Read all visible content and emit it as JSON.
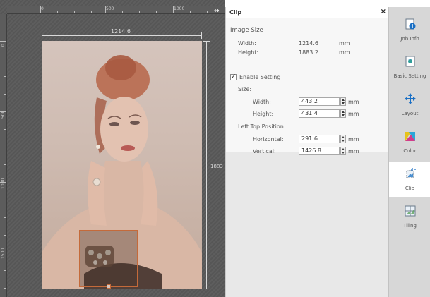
{
  "canvas": {
    "top_ruler_labels": [
      "0",
      "500",
      "1000"
    ],
    "left_ruler_labels": [
      "0",
      "500",
      "1000",
      "1500"
    ],
    "width_dimension": "1214.6",
    "height_dimension": "1883",
    "collapse_icon": "double-arrow-icon"
  },
  "panel": {
    "title": "Clip",
    "close_label": "×",
    "image_size_heading": "Image Size",
    "width_label": "Width:",
    "width_value": "1214.6",
    "width_unit": "mm",
    "height_label": "Height:",
    "height_value": "1883.2",
    "height_unit": "mm",
    "enable_setting_label": "Enable Setting",
    "enable_setting_checked": true,
    "size_heading": "Size:",
    "size_width_label": "Width:",
    "size_width_value": "443.2",
    "size_width_unit": "mm",
    "size_height_label": "Height:",
    "size_height_value": "431.4",
    "size_height_unit": "mm",
    "position_heading": "Left Top Position:",
    "horizontal_label": "Horizontal:",
    "horizontal_value": "291.6",
    "horizontal_unit": "mm",
    "vertical_label": "Vertical:",
    "vertical_value": "1426.8",
    "vertical_unit": "mm"
  },
  "sidebar": {
    "items": [
      {
        "label": "Job Info",
        "icon": "info-icon"
      },
      {
        "label": "Basic Setting",
        "icon": "basic-setting-icon"
      },
      {
        "label": "Layout",
        "icon": "layout-icon"
      },
      {
        "label": "Color",
        "icon": "color-icon"
      },
      {
        "label": "Clip",
        "icon": "clip-icon",
        "active": true
      },
      {
        "label": "Tiling",
        "icon": "tiling-icon"
      }
    ]
  },
  "colors": {
    "accent": "#1a6fc4",
    "clip_frame": "#c46a3a",
    "canvas_bg": "#5b5b5b"
  }
}
